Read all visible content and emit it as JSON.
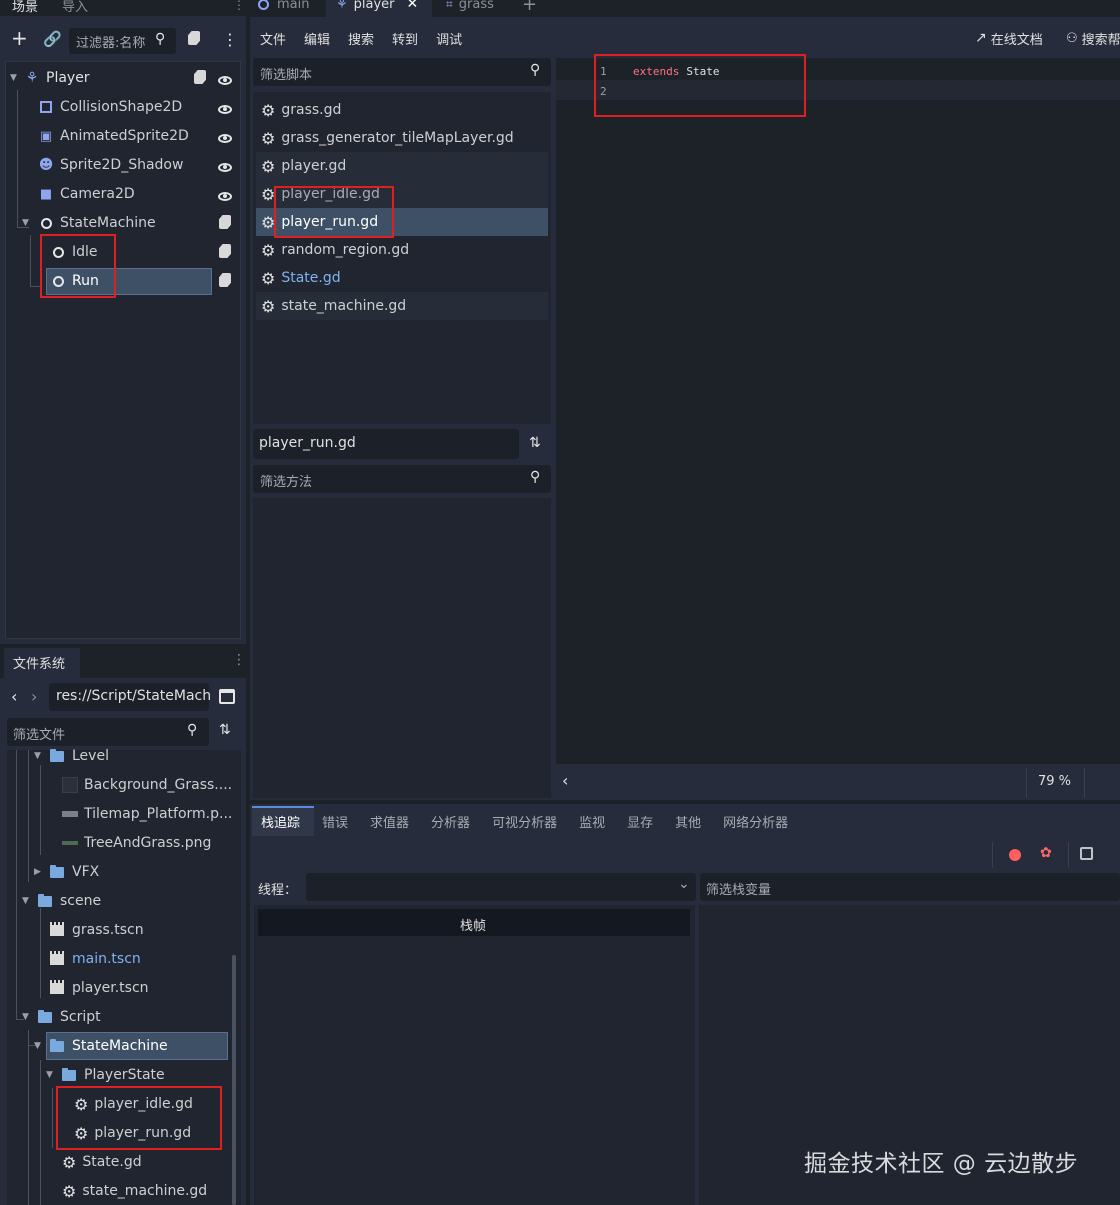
{
  "scene_dock": {
    "tabs": [
      "场景",
      "导入"
    ],
    "filter_placeholder": "过滤器:名称",
    "tree": [
      {
        "label": "Player",
        "icon": "player-node-icon"
      },
      {
        "label": "CollisionShape2D",
        "icon": "collision-shape-icon"
      },
      {
        "label": "AnimatedSprite2D",
        "icon": "animated-sprite-icon"
      },
      {
        "label": "Sprite2D_Shadow",
        "icon": "sprite-icon"
      },
      {
        "label": "Camera2D",
        "icon": "camera-icon"
      },
      {
        "label": "StateMachine",
        "icon": "node-icon"
      },
      {
        "label": "Idle",
        "icon": "node-icon"
      },
      {
        "label": "Run",
        "icon": "node-icon"
      }
    ]
  },
  "editor_tabs": [
    "main",
    "player",
    "grass"
  ],
  "script_menu": [
    "文件",
    "编辑",
    "搜索",
    "转到",
    "调试"
  ],
  "right_menu": {
    "online_docs": "在线文档",
    "search_help": "搜索帮"
  },
  "script_list": {
    "filter_placeholder": "筛选脚本",
    "items": [
      "grass.gd",
      "grass_generator_tileMapLayer.gd",
      "player.gd",
      "player_idle.gd",
      "player_run.gd",
      "random_region.gd",
      "State.gd",
      "state_machine.gd"
    ],
    "current_file": "player_run.gd",
    "method_filter_placeholder": "筛选方法"
  },
  "code": {
    "lines": [
      {
        "num": "1",
        "keyword": "extends",
        "text": "State"
      },
      {
        "num": "2",
        "keyword": "",
        "text": ""
      }
    ],
    "zoom": "79 %"
  },
  "filesystem": {
    "tab": "文件系统",
    "path": "res://Script/StateMach",
    "filter_placeholder": "筛选文件",
    "items": [
      {
        "label": "Level",
        "type": "folder"
      },
      {
        "label": "Background_Grass....",
        "type": "image"
      },
      {
        "label": "Tilemap_Platform.p...",
        "type": "image"
      },
      {
        "label": "TreeAndGrass.png",
        "type": "image"
      },
      {
        "label": "VFX",
        "type": "folder"
      },
      {
        "label": "scene",
        "type": "folder"
      },
      {
        "label": "grass.tscn",
        "type": "scene"
      },
      {
        "label": "main.tscn",
        "type": "scene"
      },
      {
        "label": "player.tscn",
        "type": "scene"
      },
      {
        "label": "Script",
        "type": "folder"
      },
      {
        "label": "StateMachine",
        "type": "folder"
      },
      {
        "label": "PlayerState",
        "type": "folder"
      },
      {
        "label": "player_idle.gd",
        "type": "script"
      },
      {
        "label": "player_run.gd",
        "type": "script"
      },
      {
        "label": "State.gd",
        "type": "script"
      },
      {
        "label": "state_machine.gd",
        "type": "script"
      }
    ]
  },
  "bottom": {
    "tabs": [
      "栈追踪",
      "错误",
      "求值器",
      "分析器",
      "可视分析器",
      "监视",
      "显存",
      "其他",
      "网络分析器"
    ],
    "thread_label": "线程：",
    "stack_frames_header": "栈帧",
    "filter_stack_placeholder": "筛选栈变量"
  },
  "watermark": "掘金技术社区 @ 云边散步"
}
